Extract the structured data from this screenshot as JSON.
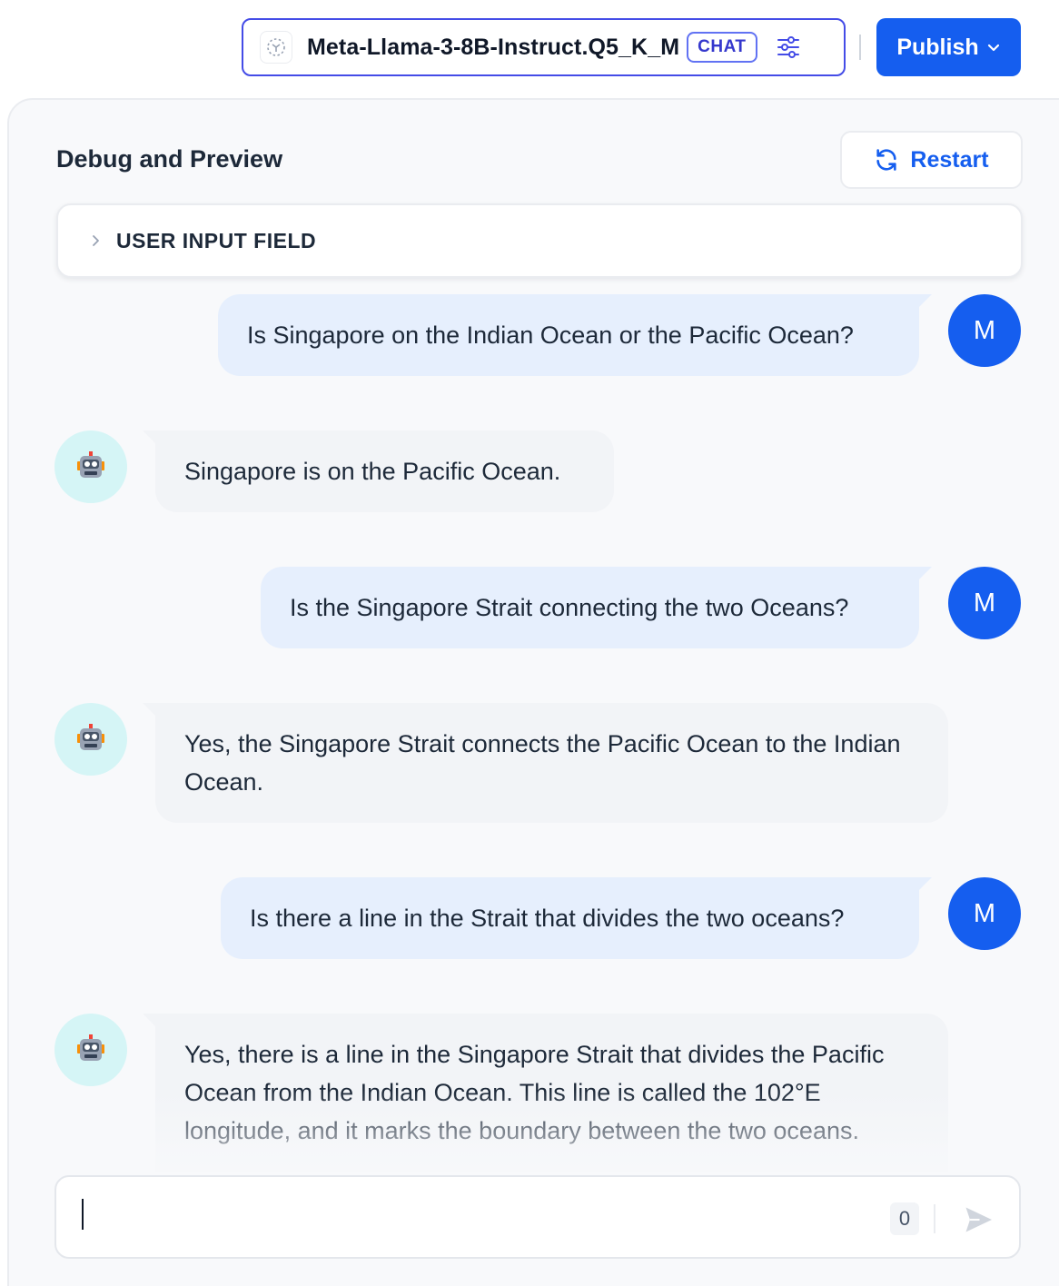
{
  "header": {
    "model_name": "Meta-Llama-3-8B-Instruct.Q5_K_M",
    "model_mode_badge": "CHAT",
    "publish_label": "Publish"
  },
  "panel": {
    "title": "Debug and Preview",
    "restart_label": "Restart",
    "user_input_section_label": "USER INPUT FIELD"
  },
  "messages": [
    {
      "role": "user",
      "avatar_initial": "M",
      "text": "Is Singapore on the Indian Ocean or the Pacific Ocean?"
    },
    {
      "role": "assistant",
      "avatar_icon": "robot-icon",
      "text": "Singapore is on the Pacific Ocean."
    },
    {
      "role": "user",
      "avatar_initial": "M",
      "text": "Is the Singapore Strait connecting the two Oceans?"
    },
    {
      "role": "assistant",
      "avatar_icon": "robot-icon",
      "text": "Yes, the Singapore Strait connects the Pacific Ocean to the Indian Ocean."
    },
    {
      "role": "user",
      "avatar_initial": "M",
      "text": "Is there a line in the Strait that divides the two oceans?"
    },
    {
      "role": "assistant",
      "avatar_icon": "robot-icon",
      "text": "Yes, there is a line in the Singapore Strait that divides the Pacific Ocean from the Indian Ocean. This line is called the 102°E longitude, and it marks the boundary between the two oceans."
    }
  ],
  "composer": {
    "value": "",
    "char_count": "0"
  },
  "colors": {
    "accent": "#155eef",
    "user_bubble": "#e6effd",
    "bot_bubble": "#f2f4f7",
    "bot_avatar_bg": "#d5f5f6"
  }
}
